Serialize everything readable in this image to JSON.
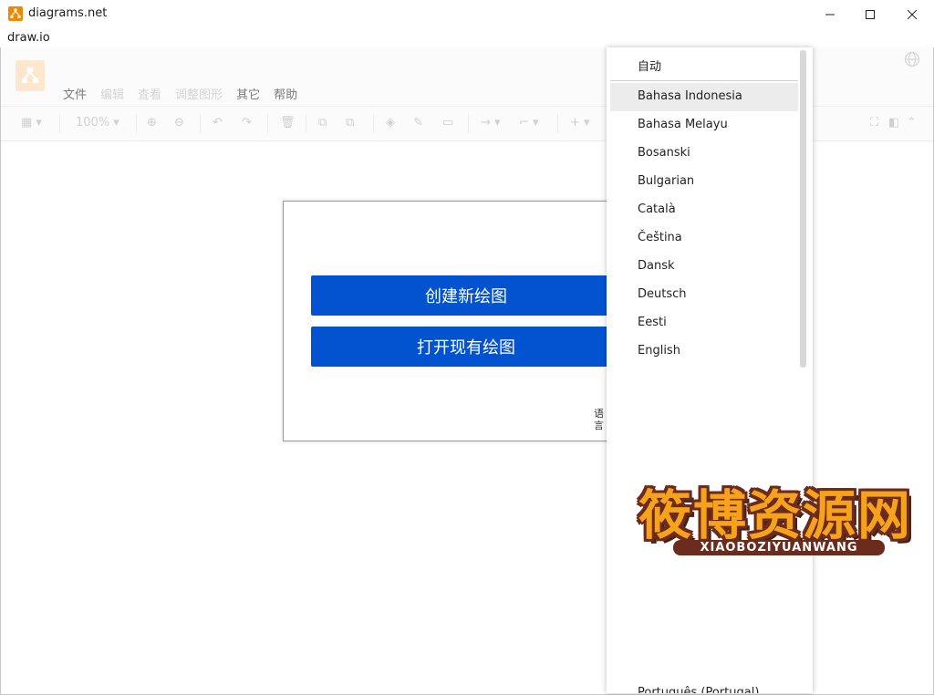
{
  "window": {
    "title": "diagrams.net",
    "menubar_label": "draw.io"
  },
  "drawio_menu": [
    "文件",
    "编辑",
    "查看",
    "调整图形",
    "其它",
    "帮助"
  ],
  "toolbar": {
    "zoom": "100%"
  },
  "splash": {
    "create_label": "创建新绘图",
    "open_label": "打开现有绘图",
    "language_link": "语言"
  },
  "language_menu": {
    "auto_label": "自动",
    "items": [
      "Bahasa Indonesia",
      "Bahasa Melayu",
      "Bosanski",
      "Bulgarian",
      "Català",
      "Čeština",
      "Dansk",
      "Deutsch",
      "Eesti",
      "English"
    ],
    "highlighted": "Bahasa Indonesia",
    "partial_bottom_item": "Português (Portugal)"
  },
  "watermark": {
    "title": "筱博资源网",
    "subtitle": "XIAOBOZIYUANWANG"
  },
  "colors": {
    "primary_button": "#0353d1",
    "app_icon": "#f08705"
  }
}
